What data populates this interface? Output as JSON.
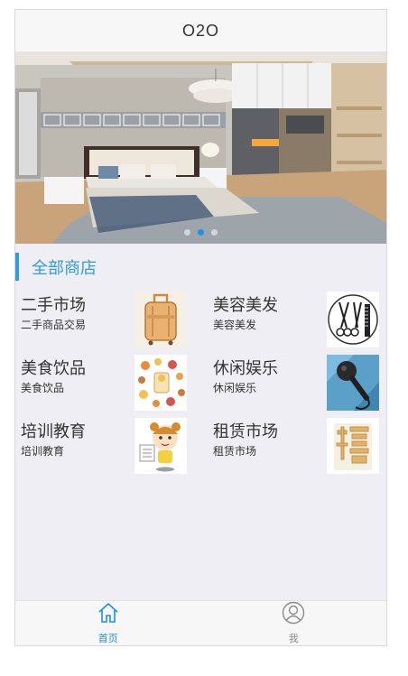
{
  "app": {
    "title": "O2O"
  },
  "banner": {
    "image": "bedroom-interior-photo",
    "slide_count": 3,
    "active_slide": 2
  },
  "section": {
    "title": "全部商店"
  },
  "stores": [
    {
      "name": "二手市场",
      "desc": "二手商品交易",
      "icon": "luggage-icon"
    },
    {
      "name": "美容美发",
      "desc": "美容美发",
      "icon": "scissors-comb-icon"
    },
    {
      "name": "美食饮品",
      "desc": "美食饮品",
      "icon": "food-collage-icon"
    },
    {
      "name": "休闲娱乐",
      "desc": "休闲娱乐",
      "icon": "microphone-icon"
    },
    {
      "name": "培训教育",
      "desc": "培训教育",
      "icon": "student-cartoon-icon"
    },
    {
      "name": "租赁市场",
      "desc": "租赁市场",
      "icon": "rent-character-icon"
    }
  ],
  "tabbar": {
    "items": [
      {
        "label": "首页",
        "icon": "home-icon",
        "active": true
      },
      {
        "label": "我",
        "icon": "user-icon",
        "active": false
      }
    ],
    "active_color": "#1e90e8",
    "inactive_color": "#8a8a8a"
  },
  "colors": {
    "accent": "#2f9be3"
  }
}
